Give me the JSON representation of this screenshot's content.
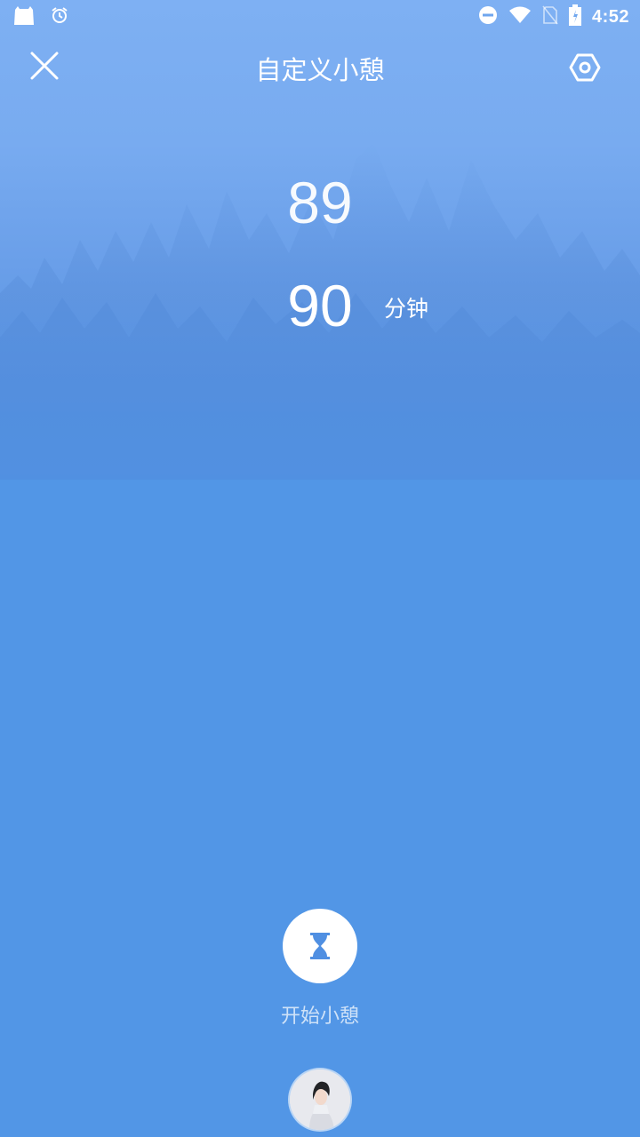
{
  "status_bar": {
    "time": "4:52",
    "left_icons": [
      "notification-app-icon",
      "alarm-icon"
    ],
    "right_icons": [
      "do-not-disturb-icon",
      "wifi-icon",
      "no-sim-icon",
      "battery-icon"
    ]
  },
  "header": {
    "title": "自定义小憩",
    "close_icon": "close-icon",
    "settings_icon": "settings-hexagon-icon"
  },
  "picker": {
    "previous_value": "89",
    "selected_value": "90",
    "unit": "分钟"
  },
  "start": {
    "icon": "hourglass-icon",
    "label": "开始小憩"
  },
  "colors": {
    "background": "#5296e6",
    "sky_top": "#7eb0f3",
    "text": "#ffffff"
  }
}
